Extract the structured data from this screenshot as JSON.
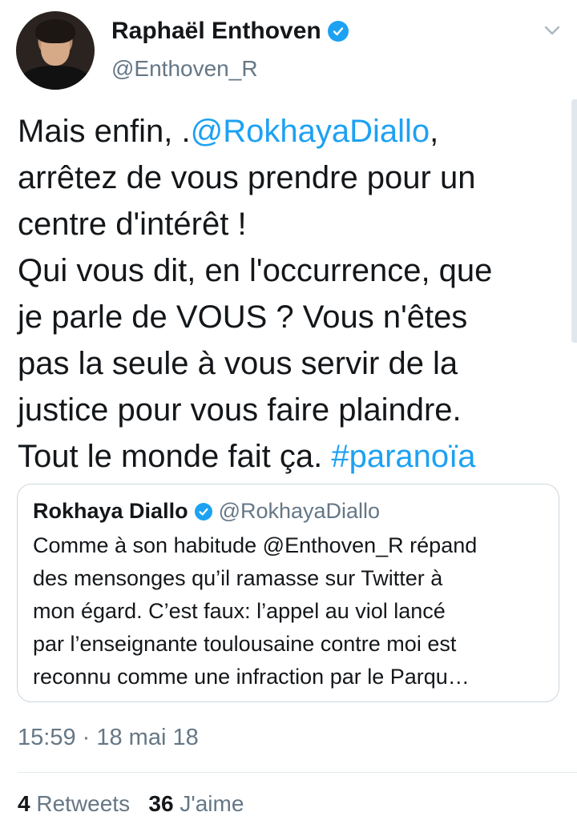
{
  "author": {
    "display_name": "Raphaël Enthoven",
    "handle": "@Enthoven_R",
    "verified": true
  },
  "tweet": {
    "parts": [
      {
        "text": "Mais enfin, .",
        "type": "text"
      },
      {
        "text": "@RokhayaDiallo",
        "type": "mention"
      },
      {
        "text": ",\narrêtez de vous prendre pour un\ncentre d'intérêt !\nQui vous dit, en l'occurrence, que\nje parle de VOUS ? Vous n'êtes\npas la seule à vous servir de la\njustice pour vous faire plaindre.\nTout le monde fait ça. ",
        "type": "text"
      },
      {
        "text": "#paranoïa",
        "type": "hashtag"
      }
    ]
  },
  "quoted_tweet": {
    "display_name": "Rokhaya Diallo",
    "handle": "@RokhayaDiallo",
    "verified": true,
    "lines": [
      "Comme à son habitude @Enthoven_R répand",
      "des mensonges qu’il ramasse sur Twitter à",
      "mon égard. C’est faux: l’appel au viol lancé",
      "par l’enseignante toulousaine contre moi est",
      "reconnu comme une infraction par le Parqu…"
    ]
  },
  "timestamp": "15:59 · 18 mai 18",
  "stats": {
    "retweets_count": "4",
    "retweets_label": "Retweets",
    "likes_count": "36",
    "likes_label": "J'aime"
  },
  "colors": {
    "link": "#1da1f2",
    "secondary_text": "#657786",
    "primary_text": "#14171a",
    "border": "#ccd6dd"
  },
  "icons": {
    "verified": "verified-badge-icon",
    "menu": "chevron-down-icon"
  }
}
